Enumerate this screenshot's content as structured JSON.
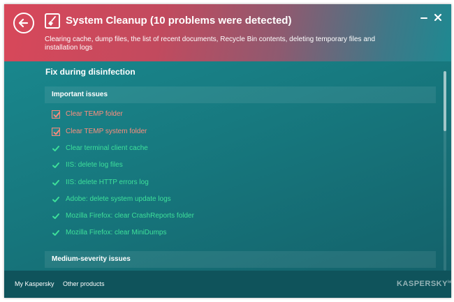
{
  "colors": {
    "header_red": "#d8485a",
    "body_teal": "#17797f",
    "footer": "#0f535b",
    "warning_text": "#ff8e7e",
    "ok_text": "#3ee09a"
  },
  "header": {
    "back_icon": "arrow-left-circle-icon",
    "app_icon": "broom-icon",
    "title": "System Cleanup (10 problems were detected)",
    "subtitle": "Clearing cache, dump files, the list of recent documents, Recycle Bin contents, deleting temporary files and installation logs",
    "minimize_label": "minimize",
    "close_label": "close"
  },
  "content": {
    "section_title": "Fix during disinfection",
    "groups": [
      {
        "header": "Important issues",
        "items": [
          {
            "label": "Clear TEMP folder",
            "state": "checkbox-checked"
          },
          {
            "label": "Clear TEMP system folder",
            "state": "checkbox-checked"
          },
          {
            "label": "Clear terminal client cache",
            "state": "fixed"
          },
          {
            "label": "IIS: delete log files",
            "state": "fixed"
          },
          {
            "label": "IIS: delete HTTP errors log",
            "state": "fixed"
          },
          {
            "label": "Adobe: delete system update logs",
            "state": "fixed"
          },
          {
            "label": "Mozilla Firefox: clear CrashReports folder",
            "state": "fixed"
          },
          {
            "label": "Mozilla Firefox: clear MiniDumps",
            "state": "fixed"
          }
        ]
      },
      {
        "header": "Medium-severity issues",
        "items": []
      }
    ],
    "scroll_position": 0
  },
  "footer": {
    "my_kaspersky": "My Kaspersky",
    "other_products": "Other products",
    "brand": "KASPERSKY",
    "brand_sup": "lab"
  }
}
